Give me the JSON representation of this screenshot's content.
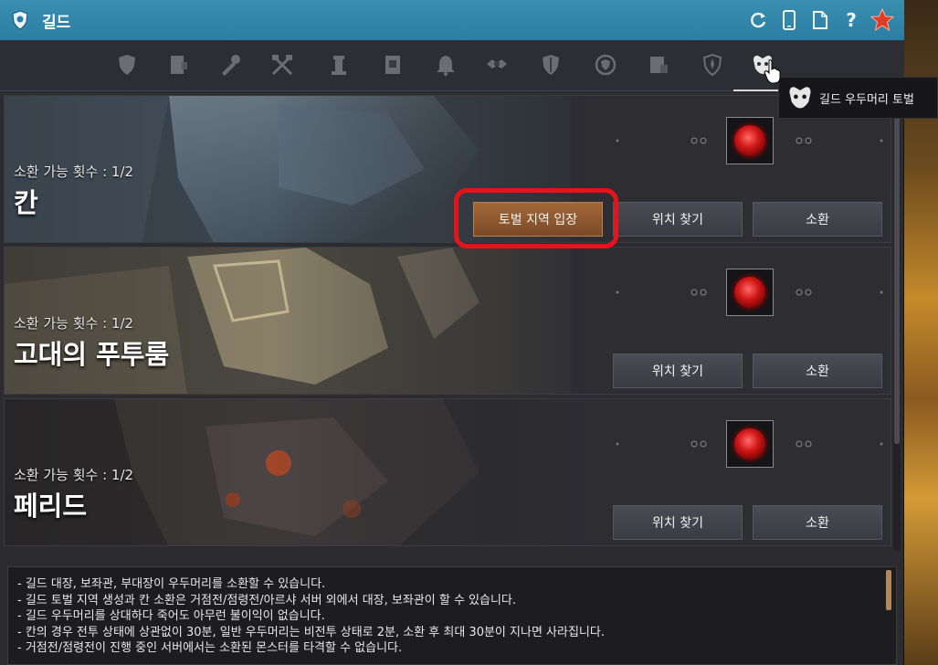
{
  "window": {
    "title": "길드",
    "title_icon": "guild-shield-icon",
    "tools": [
      {
        "name": "refresh-icon",
        "glyph": "⟳"
      },
      {
        "name": "mobile-icon",
        "glyph": "▯"
      },
      {
        "name": "document-icon",
        "glyph": "🗋"
      },
      {
        "name": "help-icon",
        "glyph": "?"
      },
      {
        "name": "star-icon",
        "glyph": "★"
      }
    ]
  },
  "tabs": [
    {
      "name": "tab-guild-info"
    },
    {
      "name": "tab-members"
    },
    {
      "name": "tab-tools"
    },
    {
      "name": "tab-battle"
    },
    {
      "name": "tab-tower"
    },
    {
      "name": "tab-scroll"
    },
    {
      "name": "tab-bell"
    },
    {
      "name": "tab-emblem"
    },
    {
      "name": "tab-defense"
    },
    {
      "name": "tab-laurel"
    },
    {
      "name": "tab-contract"
    },
    {
      "name": "tab-fleur"
    },
    {
      "name": "tab-guild-boss",
      "active": true
    }
  ],
  "tooltip": {
    "text": "길드 우두머리 토벌"
  },
  "bosses": [
    {
      "summon_label": "소환 가능 횟수 : 1/2",
      "name": "칸",
      "entry_button": "토벌 지역 입장",
      "find_button": "위치 찾기",
      "summon_button": "소환"
    },
    {
      "summon_label": "소환 가능 횟수 : 1/2",
      "name": "고대의 푸투룸",
      "find_button": "위치 찾기",
      "summon_button": "소환"
    },
    {
      "summon_label": "소환 가능 횟수 : 1/2",
      "name": "페리드",
      "find_button": "위치 찾기",
      "summon_button": "소환"
    }
  ],
  "notice": [
    "- 길드 대장, 보좌관, 부대장이 우두머리를 소환할 수 있습니다.",
    "- 길드 토벌 지역 생성과 칸 소환은 거점전/점령전/아르샤 서버 외에서 대장, 보좌관이 할 수 있습니다.",
    "- 길드 우두머리를 상대하다 죽어도 아무런 불이익이 없습니다.",
    "- 칸의 경우 전투 상태에 상관없이 30분, 일반 우두머리는 비전투 상태로 2분, 소환 후 최대 30분이 지나면 사라집니다.",
    "- 거점전/점령전이 진행 중인 서버에서는 소환된 몬스터를 타격할 수 없습니다."
  ],
  "colors": {
    "titlebar": "#2b7ea3",
    "entry_button": "#8a5530",
    "highlight": "#e3151b",
    "orb": "#d21818"
  }
}
